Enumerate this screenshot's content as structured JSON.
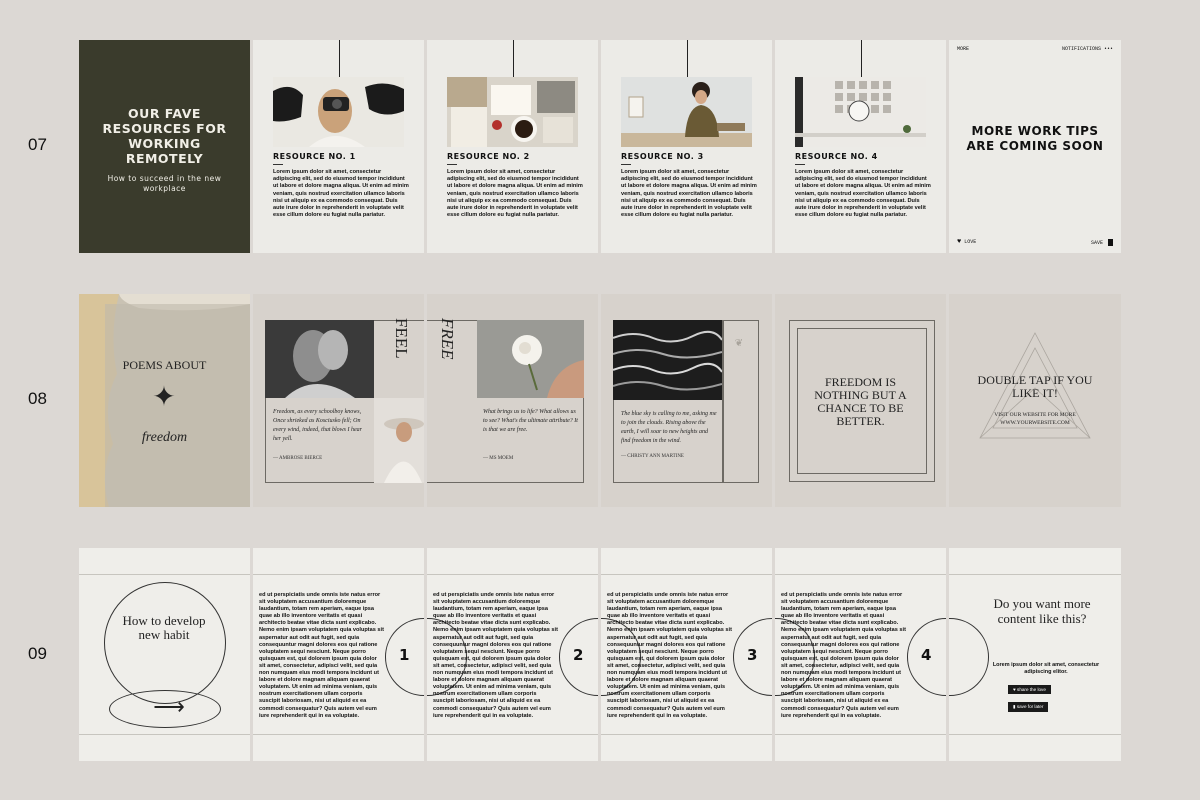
{
  "rows": {
    "r07": "07",
    "r08": "08",
    "r09": "09"
  },
  "set07": {
    "cover_title": "OUR FAVE RESOURCES FOR WORKING REMOTELY",
    "cover_subtitle": "How to succeed in the new workplace",
    "resources": [
      {
        "title": "RESOURCE NO. 1"
      },
      {
        "title": "RESOURCE NO. 2"
      },
      {
        "title": "RESOURCE NO. 3"
      },
      {
        "title": "RESOURCE NO. 4"
      }
    ],
    "body": "Lorem ipsum dolor sit amet, consectetur adipiscing elit, sed do eiusmod tempor incididunt ut labore et dolore magna aliqua. Ut enim ad minim veniam, quis nostrud exercitation ullamco laboris nisi ut aliquip ex ea commodo consequat. Duis aute irure dolor in reprehenderit in voluptate velit esse cillum dolore eu fugiat nulla pariatur.",
    "more_label": "MORE",
    "notifications_label": "NOTIFICATIONS",
    "final_title": "MORE WORK TIPS ARE COMING SOON",
    "love_label": "LOVE",
    "save_label": "SAVE"
  },
  "set08": {
    "cover_top": "POEMS ABOUT",
    "cover_bottom": "freedom",
    "feel": "FEEL",
    "free": "FREE",
    "quote1": "Freedom, as every schoolboy knows, Once shrieked as Kosciusko fell; On every wind, indeed, that blows I hear her yell.",
    "author1": "— AMBROSE BIERCE",
    "quote2": "What brings us to life? What allows us to see? What's the ultimate attribute? It is that we are free.",
    "author2": "— MS MOEM",
    "quote3": "The blue sky is calling to me, asking me to join the clouds. Rising above the earth, I will soar to new heights and find freedom in the wind.",
    "author3": "— CHRISTY ANN MARTINE",
    "center_quote": "FREEDOM IS NOTHING BUT A CHANCE TO BE BETTER.",
    "double_tap": "DOUBLE TAP IF YOU LIKE IT!",
    "visit": "VISIT OUR WEBSITE FOR MORE",
    "website": "WWW.YOURWEBSITE.COM"
  },
  "set09": {
    "cover_title": "How to develop new habit",
    "arrow": "⟶",
    "body": "ed ut perspiciatis unde omnis iste natus error sit voluptatem accusantium doloremque laudantium, totam rem aperiam, eaque ipsa quae ab illo inventore veritatis et quasi architecto beatae vitae dicta sunt explicabo. Nemo enim ipsam voluptatem quia voluptas sit aspernatur aut odit aut fugit, sed quia consequuntur magni dolores eos qui ratione voluptatem sequi nesciunt. Neque porro quisquam est, qui dolorem ipsum quia dolor sit amet, consectetur, adipisci velit, sed quia non numquam eius modi tempora incidunt ut labore et dolore magnam aliquam quaerat voluptatem. Ut enim ad minima veniam, quis nostrum exercitationem ullam corporis suscipit laboriosam, nisi ut aliquid ex ea commodi consequatur? Quis autem vel eum iure reprehenderit qui in ea voluptate.",
    "numbers": [
      "1",
      "2",
      "3",
      "4"
    ],
    "final_title": "Do you want more content like this?",
    "final_text": "Lorem ipsum dolor sit amet, consectetur adipiscing elitor.",
    "share_label": "share the love",
    "save_later_label": "save for later"
  },
  "colors": {
    "background": "#dcd8d4",
    "cover_dark": "#3a3b2c",
    "card_light": "#ecebe7",
    "card_beige": "#d7d2cc"
  }
}
